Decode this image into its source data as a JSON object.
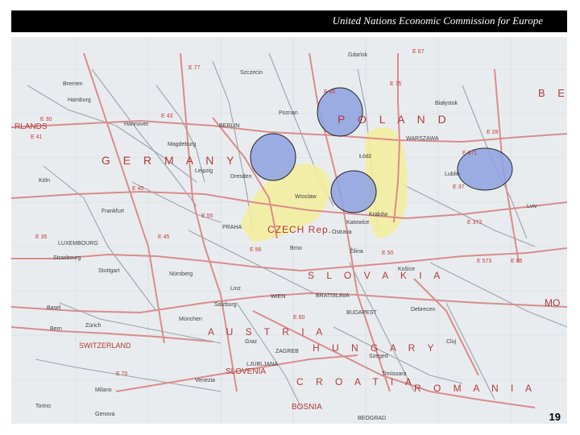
{
  "header": {
    "title": "United Nations Economic Commission for Europe"
  },
  "page_number": "19",
  "map": {
    "countries": [
      {
        "id": "poland",
        "label": "P O L A N D"
      },
      {
        "id": "germany",
        "label": "G E R M A N Y"
      },
      {
        "id": "czech",
        "label": "CZECH Rep."
      },
      {
        "id": "slovakia",
        "label": "S L O V A K I A"
      },
      {
        "id": "austria",
        "label": "A U S T R I A"
      },
      {
        "id": "hungary",
        "label": "H U N G A R Y"
      },
      {
        "id": "croatia",
        "label": "C R O A T I A"
      },
      {
        "id": "romania",
        "label": "R O M A N I A"
      },
      {
        "id": "slovenia",
        "label": "SLOVENIA"
      },
      {
        "id": "switzerland",
        "label": "SWITZERLAND"
      },
      {
        "id": "bosnia",
        "label": "BOSNIA"
      },
      {
        "id": "lands",
        "label": "RLANDS"
      },
      {
        "id": "belarus",
        "label": "B E"
      },
      {
        "id": "moldova",
        "label": "MO"
      }
    ],
    "cities": [
      {
        "id": "berlin",
        "label": "BERLIN"
      },
      {
        "id": "warszawa",
        "label": "WARSZAWA"
      },
      {
        "id": "praha",
        "label": "PRAHA"
      },
      {
        "id": "wien",
        "label": "WIEN"
      },
      {
        "id": "bratislava",
        "label": "BRATISLAVA"
      },
      {
        "id": "budapest",
        "label": "BUDAPEST"
      },
      {
        "id": "zagreb",
        "label": "ZAGREB"
      },
      {
        "id": "ljubljana",
        "label": "LJUBLJANA"
      },
      {
        "id": "luxembourg",
        "label": "LUXEMBOURG"
      },
      {
        "id": "hamburg",
        "label": "Hamburg"
      },
      {
        "id": "hannover",
        "label": "Hannover"
      },
      {
        "id": "bremen",
        "label": "Bremen"
      },
      {
        "id": "magdeburg",
        "label": "Magdeburg"
      },
      {
        "id": "leipzig",
        "label": "Leipzig"
      },
      {
        "id": "dresden",
        "label": "Dresden"
      },
      {
        "id": "poznan",
        "label": "Poznan"
      },
      {
        "id": "wroclaw",
        "label": "Wroclaw"
      },
      {
        "id": "lodz",
        "label": "Łódź"
      },
      {
        "id": "krakow",
        "label": "Kraków"
      },
      {
        "id": "katowice",
        "label": "Katowice"
      },
      {
        "id": "lublin",
        "label": "Lublin"
      },
      {
        "id": "bialystok",
        "label": "Białystok"
      },
      {
        "id": "gdansk",
        "label": "Gdańsk"
      },
      {
        "id": "szczecin",
        "label": "Szczecin"
      },
      {
        "id": "nurnberg",
        "label": "Nürnberg"
      },
      {
        "id": "munchen",
        "label": "München"
      },
      {
        "id": "stuttgart",
        "label": "Stuttgart"
      },
      {
        "id": "frankfurt",
        "label": "Frankfurt"
      },
      {
        "id": "koln",
        "label": "Köln"
      },
      {
        "id": "brno",
        "label": "Brno"
      },
      {
        "id": "ostrava",
        "label": "Ostrava"
      },
      {
        "id": "zilina",
        "label": "Žilina"
      },
      {
        "id": "kosice",
        "label": "Košice"
      },
      {
        "id": "lviv",
        "label": "Lviv"
      },
      {
        "id": "graz",
        "label": "Graz"
      },
      {
        "id": "salzburg",
        "label": "Salzburg"
      },
      {
        "id": "linz",
        "label": "Linz"
      },
      {
        "id": "debrecen",
        "label": "Debrecen"
      },
      {
        "id": "szeged",
        "label": "Szeged"
      },
      {
        "id": "cluj",
        "label": "Cluj"
      },
      {
        "id": "timisoara",
        "label": "Timisoara"
      },
      {
        "id": "beograd",
        "label": "BEOGRAD"
      },
      {
        "id": "milano",
        "label": "Milano"
      },
      {
        "id": "venezia",
        "label": "Venezia"
      },
      {
        "id": "strasbourg",
        "label": "Strasbourg"
      },
      {
        "id": "basel",
        "label": "Basel"
      },
      {
        "id": "zurich",
        "label": "Zürich"
      },
      {
        "id": "bern",
        "label": "Bern"
      },
      {
        "id": "torino",
        "label": "Torino"
      },
      {
        "id": "genova",
        "label": "Genova"
      }
    ],
    "roads": [
      "E 30",
      "E 40",
      "E 50",
      "E 55",
      "E 65",
      "E 75",
      "E 28",
      "E 67",
      "E 77",
      "E 60",
      "E 45",
      "E 35",
      "E 85",
      "E 371",
      "E 373",
      "E 70",
      "E 573",
      "E 37",
      "E 41",
      "E 43",
      "E 56"
    ],
    "colors": {
      "highlight_circle": "#8ea2e2",
      "corridor": "#f5ee9a",
      "road": "#d98c8c",
      "minor_road": "#9aa3ad"
    }
  }
}
